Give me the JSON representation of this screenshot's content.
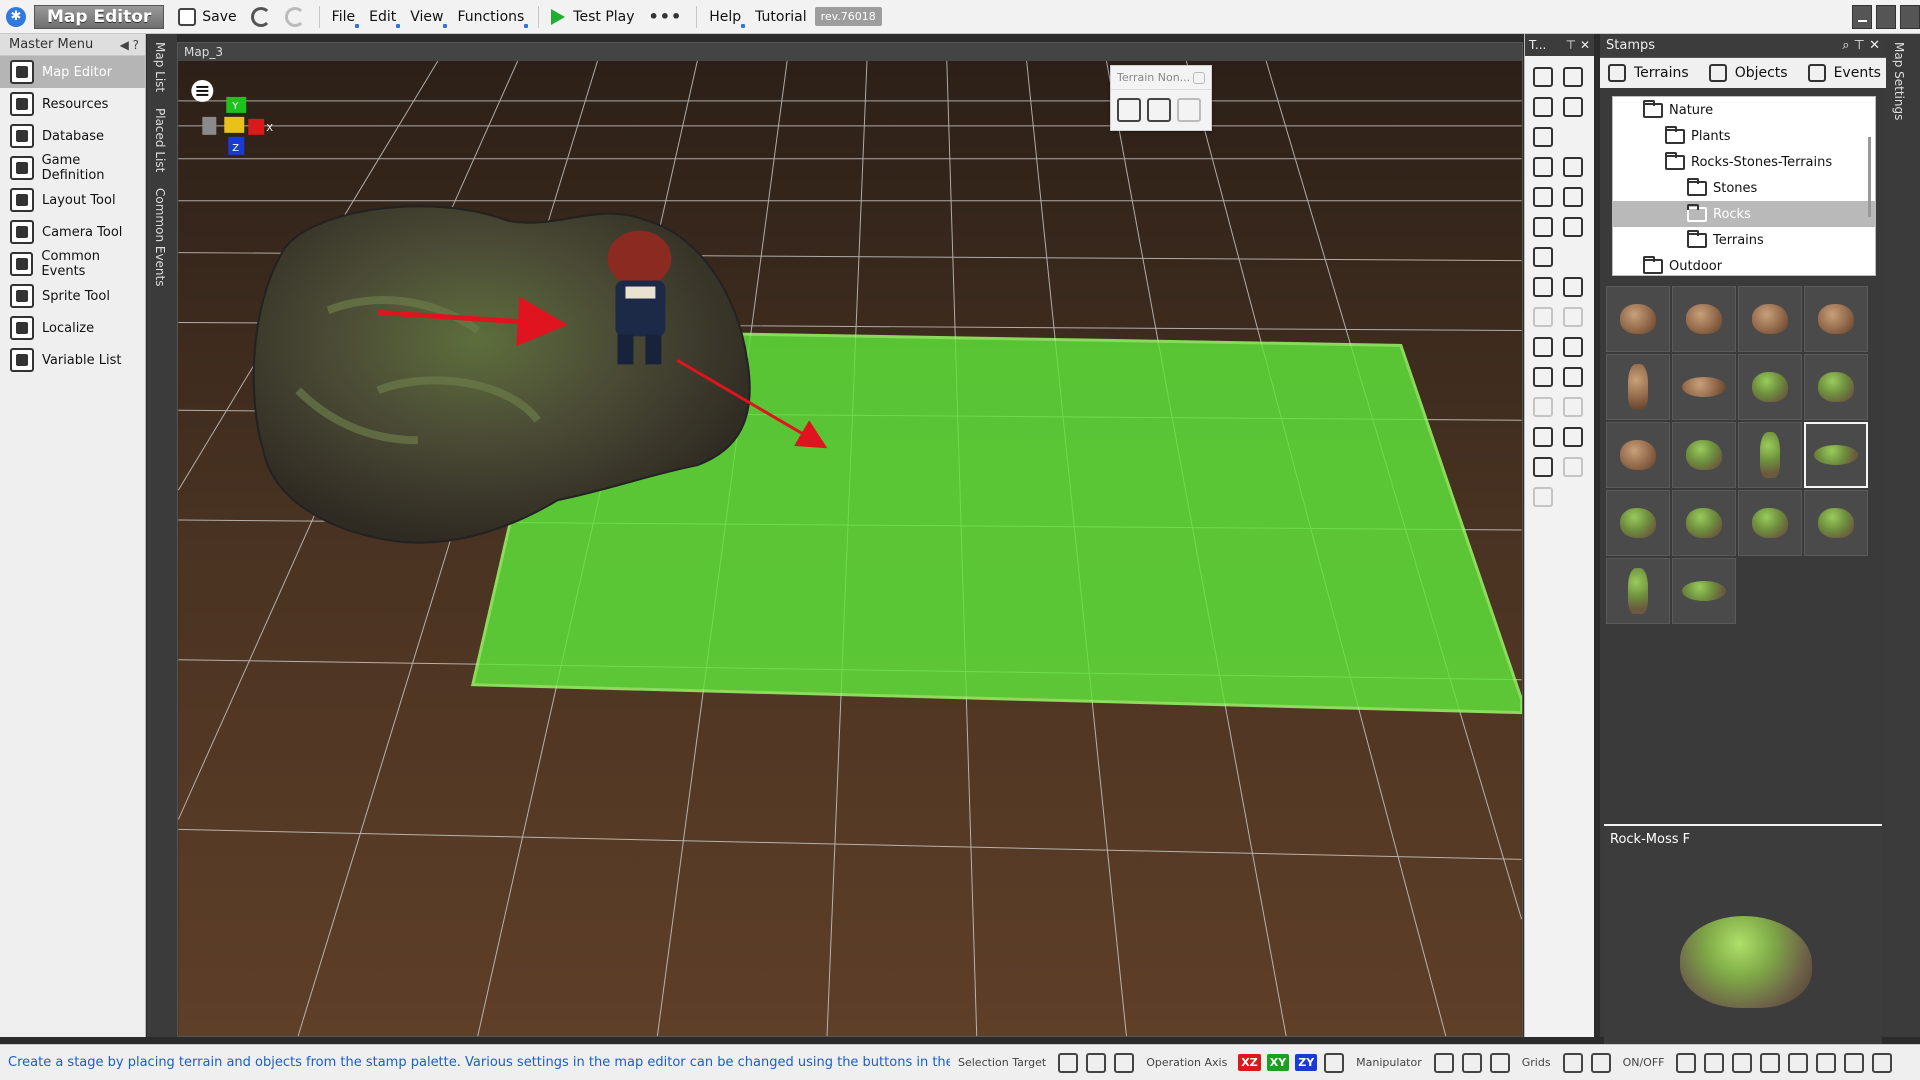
{
  "titlebar": {
    "app_title": "Map Editor",
    "save": "Save",
    "file": "File",
    "edit": "Edit",
    "view": "View",
    "functions": "Functions",
    "test_play": "Test Play",
    "more": "•••",
    "help": "Help",
    "tutorial": "Tutorial",
    "revision": "rev.76018"
  },
  "master_menu": {
    "title": "Master Menu",
    "items": [
      {
        "label": "Map Editor",
        "icon": "map-editor-icon"
      },
      {
        "label": "Resources",
        "icon": "resources-icon"
      },
      {
        "label": "Database",
        "icon": "database-icon"
      },
      {
        "label": "Game Definition",
        "icon": "game-definition-icon"
      },
      {
        "label": "Layout Tool",
        "icon": "layout-tool-icon"
      },
      {
        "label": "Camera Tool",
        "icon": "camera-tool-icon"
      },
      {
        "label": "Common Events",
        "icon": "common-events-icon"
      },
      {
        "label": "Sprite Tool",
        "icon": "sprite-tool-icon"
      },
      {
        "label": "Localize",
        "icon": "localize-icon"
      },
      {
        "label": "Variable List",
        "icon": "variable-list-icon"
      }
    ]
  },
  "side_tabs_left": [
    "Map List",
    "Placed List",
    "Common Events"
  ],
  "side_tabs_right": [
    "Map Settings"
  ],
  "viewport": {
    "map_name": "Map_3",
    "terrain_popup_title": "Terrain Non...",
    "gizmo": {
      "y": "Y",
      "x": "X",
      "z": "Z"
    }
  },
  "tool_panel": {
    "title": "T..."
  },
  "stamps": {
    "title": "Stamps",
    "tabs": [
      {
        "label": "Terrains",
        "icon": "terrain-icon"
      },
      {
        "label": "Objects",
        "icon": "objects-icon"
      },
      {
        "label": "Events",
        "icon": "events-icon"
      }
    ],
    "tree": [
      {
        "label": "Nature",
        "depth": 0,
        "open": true
      },
      {
        "label": "Plants",
        "depth": 1
      },
      {
        "label": "Rocks-Stones-Terrains",
        "depth": 1,
        "open": true
      },
      {
        "label": "Stones",
        "depth": 2
      },
      {
        "label": "Rocks",
        "depth": 2,
        "selected": true
      },
      {
        "label": "Terrains",
        "depth": 2
      },
      {
        "label": "Outdoor",
        "depth": 0
      }
    ],
    "preview_name": "Rock-Moss F"
  },
  "statusbar": {
    "message": "Create a stage by placing terrain and objects from the stamp palette.   Various settings in the map editor can be changed using the buttons in the lo",
    "selection_target": "Selection Target",
    "operation_axis": "Operation Axis",
    "axis_xz": "XZ",
    "axis_xy": "XY",
    "axis_zy": "ZY",
    "manipulator": "Manipulator",
    "grids": "Grids",
    "onoff": "ON/OFF"
  },
  "colors": {
    "accent": "#3574d8",
    "terrain_highlight": "#5fe63a",
    "arrow": "#e0141e",
    "status_text": "#1a5fc8"
  }
}
